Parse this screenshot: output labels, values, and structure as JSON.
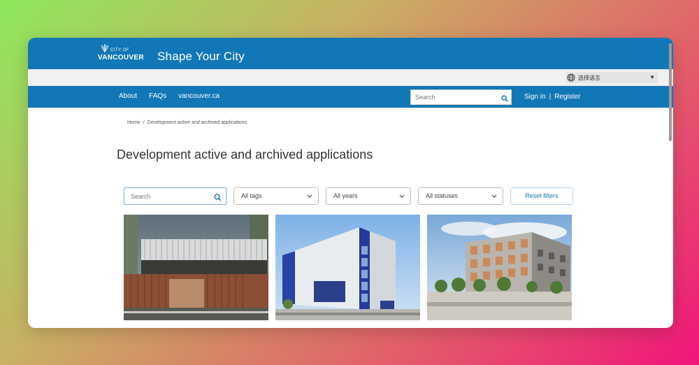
{
  "header": {
    "logo_city": "CITY OF",
    "logo_name": "VANCOUVER",
    "site_title": "Shape Your City"
  },
  "language": {
    "label": "选择语言",
    "caret": "▼",
    "icon": "globe-icon"
  },
  "nav": {
    "links": [
      "About",
      "FAQs",
      "vancouver.ca"
    ],
    "search_placeholder": "Search",
    "sign_in": "Sign in",
    "separator": "|",
    "register": "Register"
  },
  "breadcrumb": {
    "home": "Home",
    "separator": "/",
    "current": "Development active and archived applications"
  },
  "page": {
    "title": "Development active and archived applications"
  },
  "filters": {
    "search_placeholder": "Search",
    "tags": "All tags",
    "years": "All years",
    "statuses": "All statuses",
    "reset": "Reset filters"
  },
  "colors": {
    "brand_blue": "#1277b6",
    "background_gradient_start": "#8ee85c",
    "background_gradient_end": "#f0157a"
  }
}
